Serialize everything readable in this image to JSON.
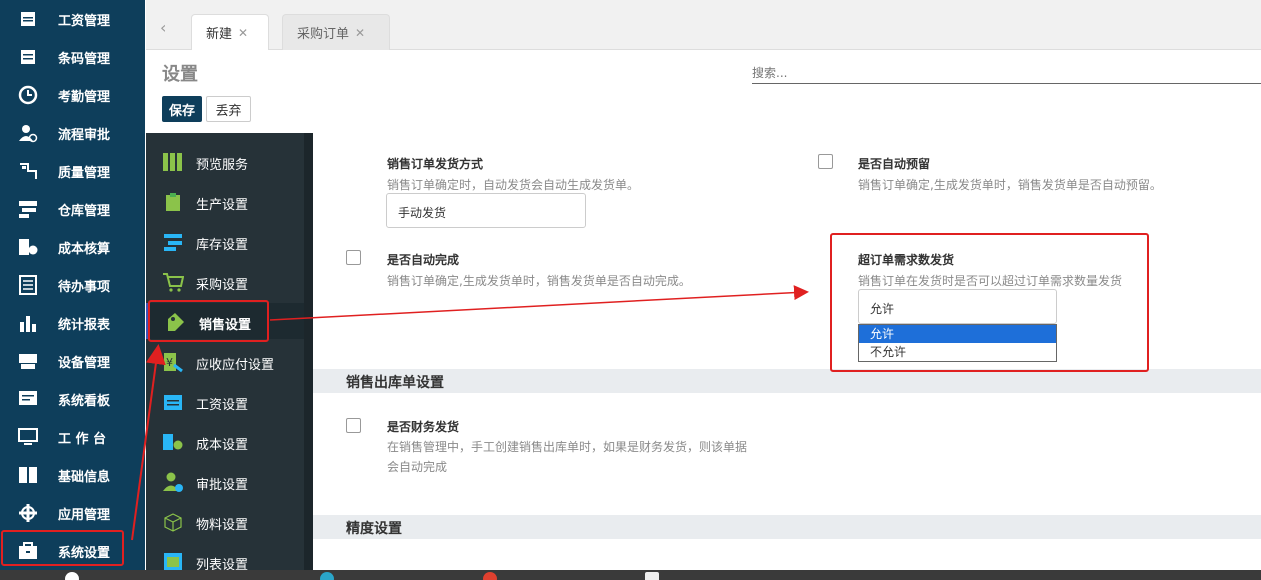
{
  "nav": {
    "items": [
      {
        "label": "工资管理",
        "icon": "payroll-icon"
      },
      {
        "label": "条码管理",
        "icon": "barcode-icon"
      },
      {
        "label": "考勤管理",
        "icon": "clock-icon"
      },
      {
        "label": "流程审批",
        "icon": "user-approval-icon"
      },
      {
        "label": "质量管理",
        "icon": "quality-icon"
      },
      {
        "label": "仓库管理",
        "icon": "warehouse-icon"
      },
      {
        "label": "成本核算",
        "icon": "cost-icon"
      },
      {
        "label": "待办事项",
        "icon": "checklist-icon"
      },
      {
        "label": "统计报表",
        "icon": "bar-chart-icon"
      },
      {
        "label": "设备管理",
        "icon": "device-icon"
      },
      {
        "label": "系统看板",
        "icon": "dashboard-icon"
      },
      {
        "label": "工 作 台",
        "icon": "monitor-icon"
      },
      {
        "label": "基础信息",
        "icon": "book-icon"
      },
      {
        "label": "应用管理",
        "icon": "apps-icon"
      },
      {
        "label": "系统设置",
        "icon": "toolbox-icon"
      }
    ]
  },
  "tabs": [
    {
      "label": "新建",
      "active": true
    },
    {
      "label": "采购订单",
      "active": false
    }
  ],
  "header": {
    "title": "设置",
    "search_placeholder": "搜索...",
    "save_label": "保存",
    "discard_label": "丢弃"
  },
  "settings_menu": {
    "items": [
      {
        "label": "预览服务",
        "icon": "preview-icon"
      },
      {
        "label": "生产设置",
        "icon": "clipboard-icon"
      },
      {
        "label": "库存设置",
        "icon": "inventory-icon"
      },
      {
        "label": "采购设置",
        "icon": "cart-icon"
      },
      {
        "label": "销售设置",
        "icon": "sales-tag-icon",
        "active": true
      },
      {
        "label": "应收应付设置",
        "icon": "yen-icon"
      },
      {
        "label": "工资设置",
        "icon": "wallet-icon"
      },
      {
        "label": "成本设置",
        "icon": "cost-settings-icon"
      },
      {
        "label": "审批设置",
        "icon": "approval-icon"
      },
      {
        "label": "物料设置",
        "icon": "cube-icon"
      },
      {
        "label": "列表设置",
        "icon": "list-image-icon"
      }
    ]
  },
  "content": {
    "ship_method": {
      "title": "销售订单发货方式",
      "desc": "销售订单确定时，自动发货会自动生成发货单。",
      "value": "手动发货"
    },
    "auto_reserve": {
      "title": "是否自动预留",
      "desc": "销售订单确定,生成发货单时，销售发货单是否自动预留。",
      "checked": false
    },
    "auto_complete": {
      "title": "是否自动完成",
      "desc": "销售订单确定,生成发货单时，销售发货单是否自动完成。",
      "checked": false
    },
    "over_ship": {
      "title": "超订单需求数发货",
      "desc": "销售订单在发货时是否可以超过订单需求数量发货",
      "value": "允许",
      "options": [
        "允许",
        "不允许"
      ],
      "highlighted_option": "允许"
    },
    "section_outbound": {
      "title": "销售出库单设置"
    },
    "finance_ship": {
      "title": "是否财务发货",
      "desc_line1": "在销售管理中，手工创建销售出库单时，如果是财务发货，则该单据",
      "desc_line2": "会自动完成",
      "checked": false
    },
    "section_precision": {
      "title": "精度设置"
    }
  },
  "colors": {
    "nav_bg": "#0e3e5b",
    "submenu_bg": "#263238",
    "highlight": "#e02020",
    "dropdown_selected": "#1e6fd9"
  }
}
